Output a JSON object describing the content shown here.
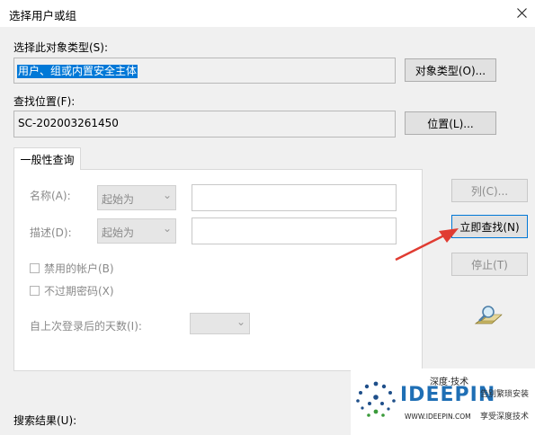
{
  "window": {
    "title": "选择用户或组"
  },
  "object_type": {
    "label": "选择此对象类型(S):",
    "value": "用户、组或内置安全主体",
    "button": "对象类型(O)..."
  },
  "location": {
    "label": "查找位置(F):",
    "value": "SC-202003261450",
    "button": "位置(L)..."
  },
  "tab": {
    "label": "一般性查询"
  },
  "query": {
    "name_label": "名称(A):",
    "name_mode": "起始为",
    "desc_label": "描述(D):",
    "desc_mode": "起始为",
    "disabled_accounts": "禁用的帐户(B)",
    "no_expire_pwd": "不过期密码(X)",
    "days_label": "自上次登录后的天数(I):"
  },
  "actions": {
    "columns": "列(C)...",
    "find_now": "立即查找(N)",
    "stop": "停止(T)"
  },
  "results": {
    "label": "搜索结果(U):"
  },
  "watermark": {
    "top": "深度·技术",
    "brand": "IDEEPIN",
    "url": "WWW.IDEEPIN.COM",
    "line1": "告别繁琐安装",
    "line2": "享受深度技术"
  },
  "colors": {
    "accent": "#0078d7",
    "arrow": "#e03c32",
    "brand_blue": "#1f6fb5"
  }
}
